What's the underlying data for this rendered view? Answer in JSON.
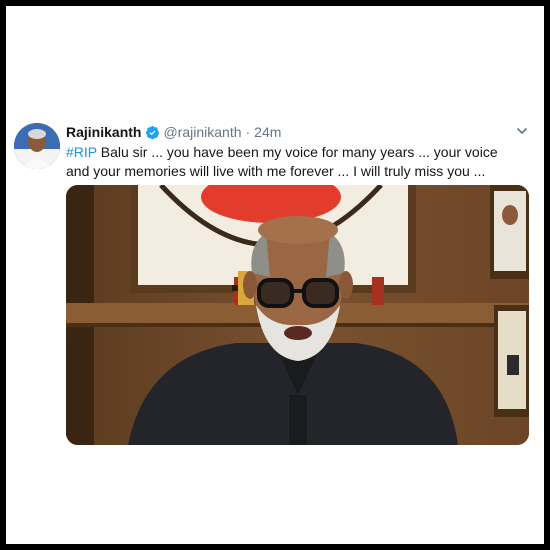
{
  "tweet": {
    "author_name": "Rajinikanth",
    "handle": "@rajinikanth",
    "separator": "·",
    "time": "24m",
    "hashtag": "#RIP",
    "text": " Balu sir ... you have been my voice for many years ... your voice and your memories will live with me forever ... I will truly miss you ..."
  },
  "icons": {
    "verified": "verified-badge-icon",
    "more": "chevron-down-icon"
  },
  "colors": {
    "link": "#1b95e0",
    "muted": "#657786",
    "text": "#14171a",
    "verified": "#1da1f2"
  }
}
